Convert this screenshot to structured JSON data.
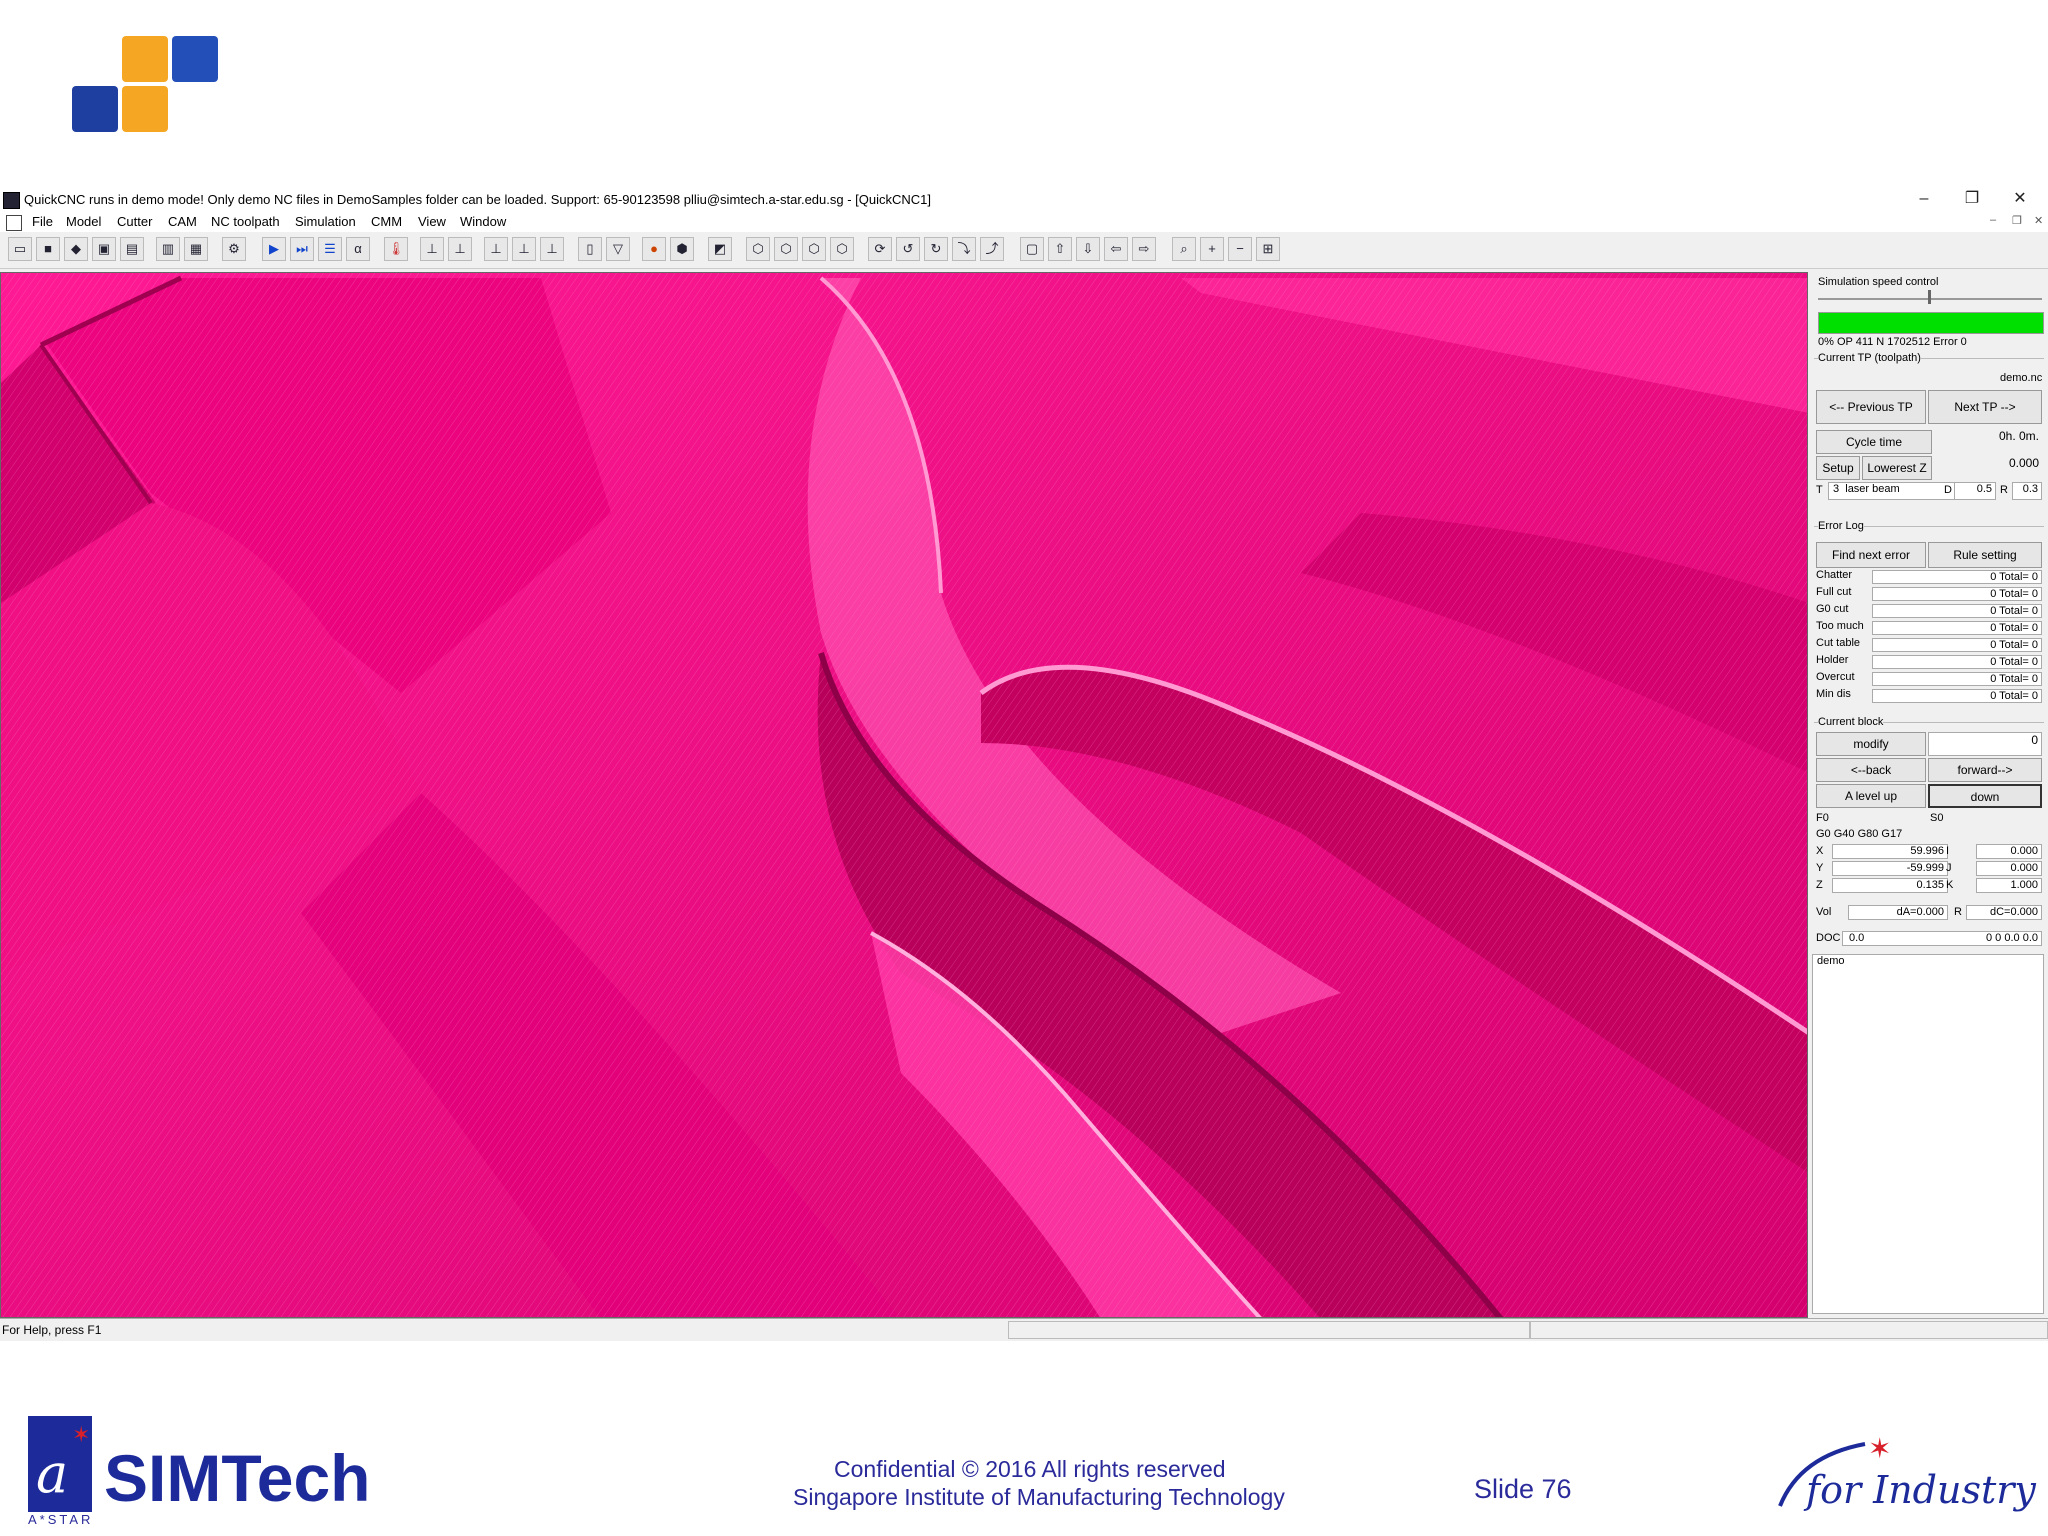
{
  "window": {
    "title": "QuickCNC runs in demo mode! Only demo NC files in DemoSamples folder can be loaded. Support: 65-90123598 plliu@simtech.a-star.edu.sg - [QuickCNC1]",
    "minimize": "–",
    "restore": "❐",
    "close": "✕"
  },
  "menu": [
    "File",
    "Model",
    "Cutter",
    "CAM",
    "NC toolpath",
    "Simulation",
    "CMM",
    "View",
    "Window"
  ],
  "panel": {
    "speed_label": "Simulation speed control",
    "status_line": "0% OP 411   N 1702512  Error 0",
    "current_tp_label": "Current TP (toolpath)",
    "current_tp_file": "demo.nc",
    "prev_tp": "<-- Previous TP",
    "next_tp": "Next TP -->",
    "cycle_time": "Cycle time",
    "cycle_value": "0h. 0m.",
    "setup": "Setup",
    "lowest_z": "Lowerest Z",
    "lowest_z_value": "0.000",
    "tool_t": "T",
    "tool_num": "3",
    "tool_name": "laser beam",
    "tool_d": "D",
    "tool_d_value": "0.5",
    "tool_r": "R",
    "tool_r_value": "0.3",
    "error_log_label": "Error Log",
    "find_next_error": "Find next error",
    "rule_setting": "Rule setting",
    "errors": [
      {
        "name": "Chatter",
        "value": "0 Total= 0"
      },
      {
        "name": "Full cut",
        "value": "0 Total= 0"
      },
      {
        "name": "G0 cut",
        "value": "0 Total= 0"
      },
      {
        "name": "Too much",
        "value": "0 Total= 0"
      },
      {
        "name": "Cut table",
        "value": "0 Total= 0"
      },
      {
        "name": "Holder",
        "value": "0 Total= 0"
      },
      {
        "name": "Overcut",
        "value": "0 Total= 0"
      },
      {
        "name": "Min dis",
        "value": "0 Total= 0"
      }
    ],
    "current_block_label": "Current block",
    "modify": "modify",
    "block_value": "0",
    "back": "<--back",
    "forward": "forward-->",
    "level_up": "A level up",
    "down": "down",
    "f_value": "F0",
    "s_value": "S0",
    "gcodes": "G0   G40   G80   G17",
    "x_label": "X",
    "x_value": "59.996",
    "i_label": "I",
    "i_value": "0.000",
    "y_label": "Y",
    "y_value": "-59.999",
    "j_label": "J",
    "j_value": "0.000",
    "z_label": "Z",
    "z_value": "0.135",
    "k_label": "K",
    "k_value": "1.000",
    "vol_label": "Vol",
    "da_value": "dA=0.000",
    "r_label": "R",
    "dc_value": "dC=0.000",
    "doc_label": "DOC",
    "doc_value": "0.0",
    "doc_rest": "0   0   0.0   0.0",
    "notes": "demo",
    "accent_green": "#00e000"
  },
  "status_bar": "For Help, press F1",
  "footer": {
    "org": "SIMTech",
    "astar": "A*STAR",
    "confidential": "Confidential © 2016  All rights reserved",
    "institute": "Singapore Institute of Manufacturing Technology",
    "slide": "Slide 76",
    "tagline": "for Industry"
  }
}
